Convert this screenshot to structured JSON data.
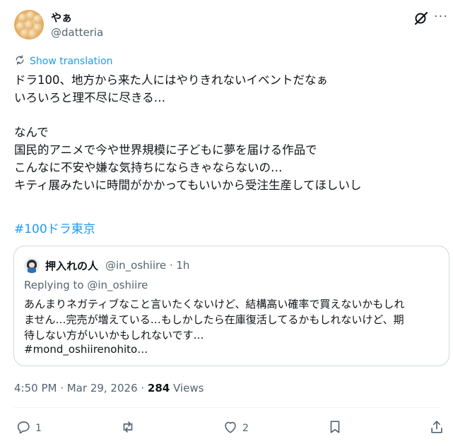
{
  "author": {
    "display_name": "やぁ",
    "handle": "@datteria"
  },
  "translate_label": "Show translation",
  "tweet": {
    "lines": [
      "ドラ100、地方から来た人にはやりきれないイベントだなぁ",
      "いろいろと理不尽に尽きる…",
      "",
      "なんで",
      "国民的アニメで今や世界規模に子どもに夢を届ける作品で",
      "こんなに不安や嫌な気持ちにならきゃならないの…",
      "キティ展みたいに時間がかかってもいいから受注生産してほしいし"
    ],
    "hashtag": "#100ドラ東京"
  },
  "quote": {
    "display_name": "押入れの人",
    "meta": "@in_oshiire · 1h",
    "replying_to": "Replying to @in_oshiire",
    "lines": [
      "あんまりネガティブなこと言いたくないけど、結構高い確率で買えないかもしれ",
      "ません…完売が増えている…もしかしたら在庫復活してるかもしれないけど、期",
      "待しない方がいいかもしれないです…"
    ],
    "hashtag": "#mond_oshiirenohito…"
  },
  "timestamp": {
    "time": "4:50 PM · Mar 29, 2026 · ",
    "views_count": "284",
    "views_label": " Views"
  },
  "actions": {
    "reply_count": "1",
    "repost_count": "",
    "like_count": "2"
  },
  "icons": [
    "grok-icon",
    "more-icon",
    "translate-icon",
    "reply-icon",
    "repost-icon",
    "like-icon",
    "bookmark-icon",
    "share-icon"
  ],
  "colors": {
    "accent": "#1d9bf0",
    "text": "#0f1419",
    "secondary": "#536471",
    "border": "#cfd9de"
  }
}
